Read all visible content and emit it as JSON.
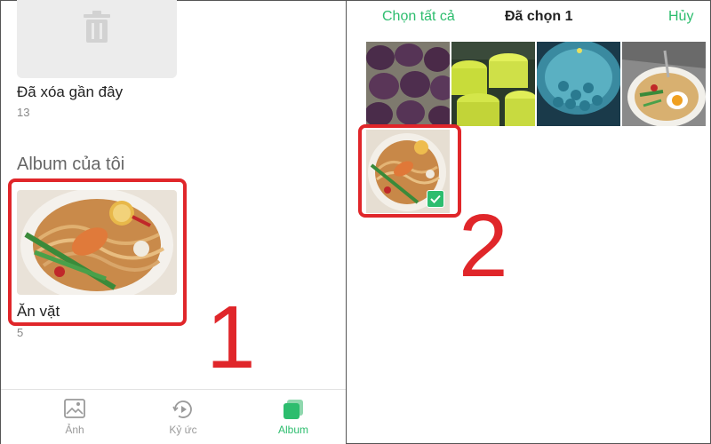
{
  "left": {
    "deleted_album": {
      "name": "Đã xóa gần đây",
      "count": "13"
    },
    "section_title": "Album của tôi",
    "my_album": {
      "name": "Ăn vặt",
      "count": "5"
    },
    "callout_number": "1"
  },
  "right": {
    "top_bar": {
      "select_all": "Chọn tất cả",
      "title": "Đã chọn 1",
      "cancel": "Hủy"
    },
    "callout_number": "2",
    "photos": [
      {
        "icon": "purple-food-photo"
      },
      {
        "icon": "jars-photo"
      },
      {
        "icon": "blue-drink-photo"
      },
      {
        "icon": "noodle-egg-photo"
      }
    ],
    "selected_photo": {
      "icon": "noodle-bowl-photo",
      "selected": true
    }
  },
  "bottom_nav": {
    "items": [
      {
        "label": "Ảnh",
        "icon": "photo-icon",
        "active": false
      },
      {
        "label": "Kỷ ức",
        "icon": "memories-icon",
        "active": false
      },
      {
        "label": "Album",
        "icon": "album-icon",
        "active": true
      }
    ]
  },
  "colors": {
    "accent": "#2dbd6e",
    "highlight": "#e0262a"
  }
}
